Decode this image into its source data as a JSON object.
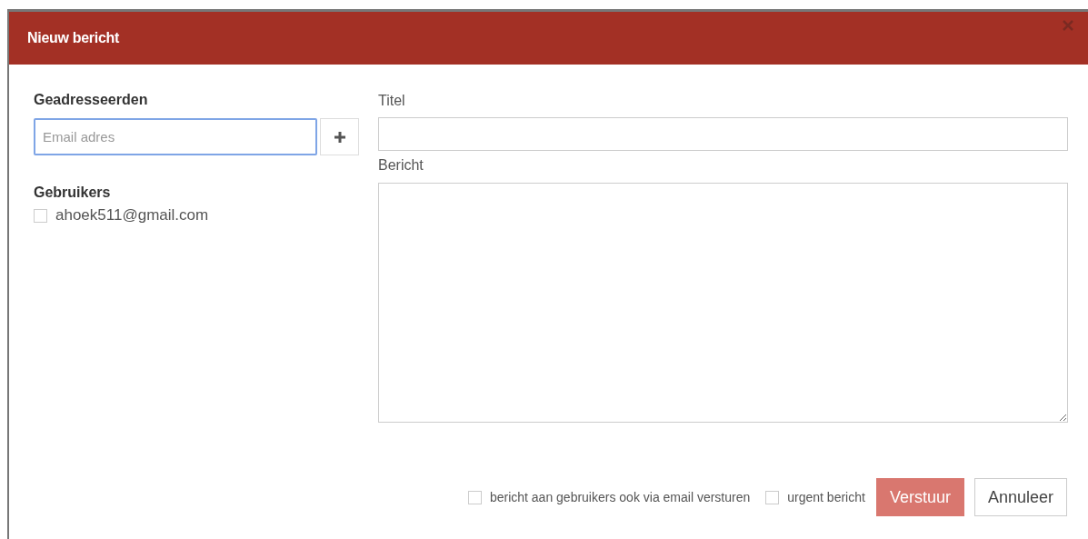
{
  "dialog": {
    "title": "Nieuw bericht"
  },
  "recipients": {
    "heading": "Geadresseerden",
    "email_field": {
      "placeholder": "Email adres"
    }
  },
  "users": {
    "heading": "Gebruikers",
    "items": [
      {
        "label": "ahoek511@gmail.com",
        "checked": false
      }
    ]
  },
  "title_field": {
    "label": "Titel"
  },
  "message_field": {
    "label": "Bericht"
  },
  "options": [
    {
      "label": "bericht aan gebruikers ook via email versturen",
      "checked": false
    },
    {
      "label": "urgent bericht",
      "checked": false
    }
  ],
  "buttons": [
    {
      "label": "Verstuur",
      "kind": "primary",
      "disabled": true
    },
    {
      "label": "Annuleer",
      "kind": "default",
      "disabled": false
    }
  ]
}
